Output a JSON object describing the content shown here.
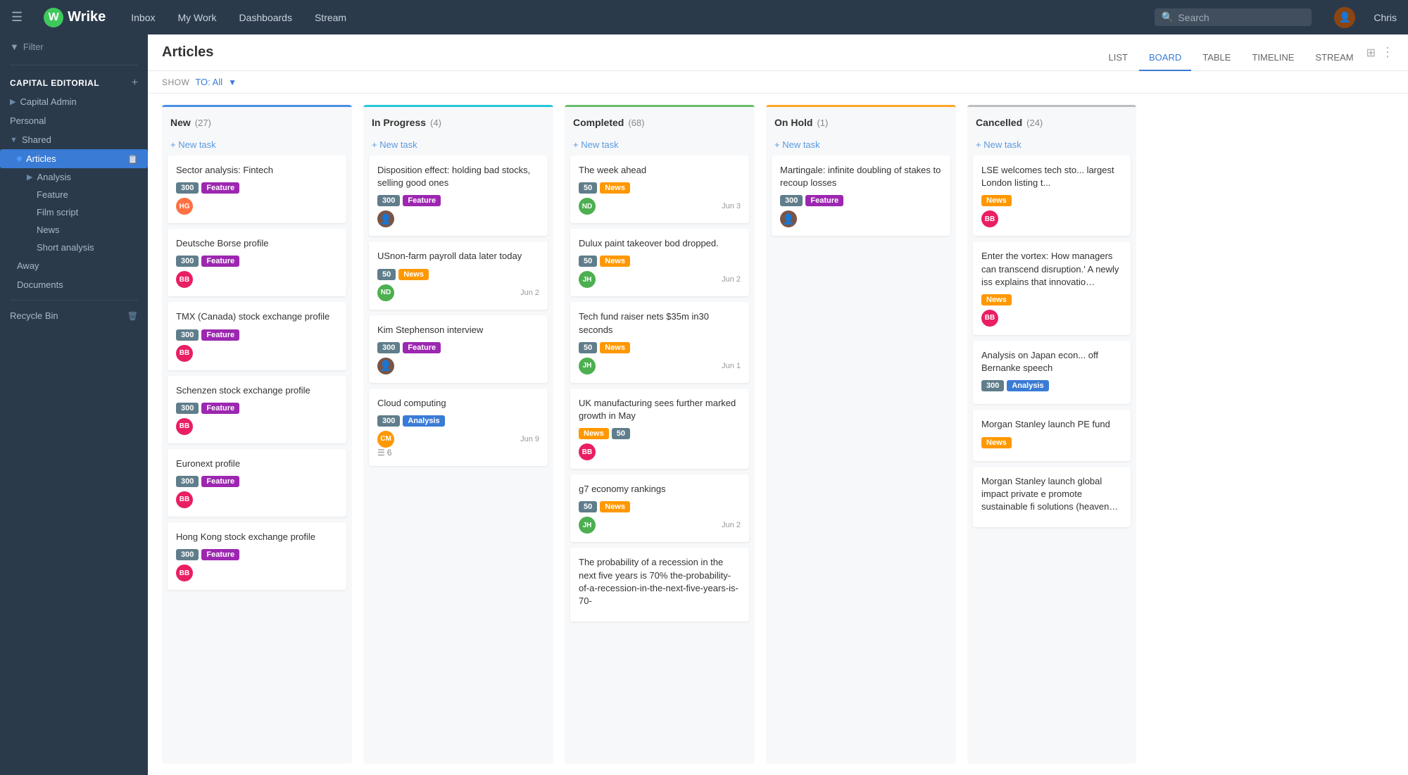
{
  "topnav": {
    "logo_text": "Wrike",
    "hamburger": "☰",
    "nav_items": [
      "Inbox",
      "My Work",
      "Dashboards",
      "Stream"
    ],
    "search_placeholder": "Search",
    "user_name": "Chris"
  },
  "sidebar": {
    "filter_label": "Filter",
    "capital_editorial": "CAPITAL EDITORIAL",
    "items": [
      {
        "label": "Capital Admin",
        "indent": 0
      },
      {
        "label": "Personal",
        "indent": 0
      },
      {
        "label": "Shared",
        "indent": 0,
        "expanded": true
      },
      {
        "label": "Articles",
        "indent": 1,
        "active": true
      },
      {
        "label": "Analysis",
        "indent": 2
      },
      {
        "label": "Feature",
        "indent": 2
      },
      {
        "label": "Film script",
        "indent": 2
      },
      {
        "label": "News",
        "indent": 2
      },
      {
        "label": "Short analysis",
        "indent": 2
      },
      {
        "label": "Away",
        "indent": 1
      },
      {
        "label": "Documents",
        "indent": 1
      },
      {
        "label": "Recycle Bin",
        "indent": 0
      }
    ]
  },
  "content": {
    "title": "Articles",
    "tabs": [
      "LIST",
      "BOARD",
      "TABLE",
      "TIMELINE",
      "STREAM"
    ],
    "active_tab": "BOARD",
    "filter_label": "SHOW",
    "filter_value": "TO: All"
  },
  "columns": [
    {
      "id": "new",
      "title": "New",
      "count": 27,
      "bar_class": "blue",
      "new_task_label": "+ New task",
      "cards": [
        {
          "title": "Sector analysis: Fintech",
          "tags": [
            {
              "label": "300",
              "class": "num"
            },
            {
              "label": "Feature",
              "class": "feature"
            }
          ],
          "avatar": "HG",
          "avatar_class": "avatar-hg",
          "date": ""
        },
        {
          "title": "Deutsche Borse profile",
          "tags": [
            {
              "label": "300",
              "class": "num"
            },
            {
              "label": "Feature",
              "class": "feature"
            }
          ],
          "avatar": "BB",
          "avatar_class": "avatar-bb",
          "date": ""
        },
        {
          "title": "TMX (Canada) stock exchange profile",
          "tags": [
            {
              "label": "300",
              "class": "num"
            },
            {
              "label": "Feature",
              "class": "feature"
            }
          ],
          "avatar": "BB",
          "avatar_class": "avatar-bb",
          "date": ""
        },
        {
          "title": "Schenzen stock exchange profile",
          "tags": [
            {
              "label": "300",
              "class": "num"
            },
            {
              "label": "Feature",
              "class": "feature"
            }
          ],
          "avatar": "BB",
          "avatar_class": "avatar-bb",
          "date": ""
        },
        {
          "title": "Euronext profile",
          "tags": [
            {
              "label": "300",
              "class": "num"
            },
            {
              "label": "Feature",
              "class": "feature"
            }
          ],
          "avatar": "BB",
          "avatar_class": "avatar-bb",
          "date": ""
        },
        {
          "title": "Hong Kong stock exchange profile",
          "tags": [
            {
              "label": "300",
              "class": "num"
            },
            {
              "label": "Feature",
              "class": "feature"
            }
          ],
          "avatar": "BB",
          "avatar_class": "avatar-bb",
          "date": ""
        }
      ]
    },
    {
      "id": "inprogress",
      "title": "In Progress",
      "count": 4,
      "bar_class": "teal",
      "new_task_label": "+ New task",
      "cards": [
        {
          "title": "Disposition effect: holding bad stocks, selling good ones",
          "tags": [
            {
              "label": "300",
              "class": "num"
            },
            {
              "label": "Feature",
              "class": "feature"
            }
          ],
          "avatar": "photo",
          "avatar_class": "avatar-photo",
          "date": ""
        },
        {
          "title": "USnon-farm payroll data later today",
          "tags": [
            {
              "label": "50",
              "class": "num"
            },
            {
              "label": "News",
              "class": "news"
            }
          ],
          "avatar": "ND",
          "avatar_class": "avatar-nd",
          "date": "Jun 2"
        },
        {
          "title": "Kim Stephenson interview",
          "tags": [
            {
              "label": "300",
              "class": "num"
            },
            {
              "label": "Feature",
              "class": "feature"
            }
          ],
          "avatar": "photo",
          "avatar_class": "avatar-photo",
          "date": ""
        },
        {
          "title": "Cloud computing",
          "tags": [
            {
              "label": "300",
              "class": "num"
            },
            {
              "label": "Analysis",
              "class": "analysis"
            }
          ],
          "avatar": "CM",
          "avatar_class": "avatar-cm",
          "date": "Jun 9",
          "subtasks": 6
        }
      ]
    },
    {
      "id": "completed",
      "title": "Completed",
      "count": 68,
      "bar_class": "green",
      "new_task_label": "+ New task",
      "cards": [
        {
          "title": "The week ahead",
          "tags": [
            {
              "label": "50",
              "class": "num"
            },
            {
              "label": "News",
              "class": "news"
            }
          ],
          "avatar": "ND",
          "avatar_class": "avatar-nd",
          "date": "Jun 3"
        },
        {
          "title": "Dulux paint takeover bod dropped.",
          "tags": [
            {
              "label": "50",
              "class": "num"
            },
            {
              "label": "News",
              "class": "news"
            }
          ],
          "avatar": "JH",
          "avatar_class": "avatar-jh",
          "date": "Jun 2"
        },
        {
          "title": "Tech fund raiser nets $35m in30 seconds",
          "tags": [
            {
              "label": "50",
              "class": "num"
            },
            {
              "label": "News",
              "class": "news"
            }
          ],
          "avatar": "JH",
          "avatar_class": "avatar-jh",
          "date": "Jun 1"
        },
        {
          "title": "UK manufacturing sees further marked growth in May",
          "tags": [
            {
              "label": "News",
              "class": "news"
            },
            {
              "label": "50",
              "class": "num"
            }
          ],
          "avatar": "BB",
          "avatar_class": "avatar-bb",
          "date": ""
        },
        {
          "title": "g7 economy rankings",
          "tags": [
            {
              "label": "50",
              "class": "num"
            },
            {
              "label": "News",
              "class": "news"
            }
          ],
          "avatar": "JH",
          "avatar_class": "avatar-jh",
          "date": "Jun 2"
        },
        {
          "title": "The probability of a recession in the next five years is 70% the-probability-of-a-recession-in-the-next-five-years-is-70-",
          "tags": [],
          "avatar": "",
          "avatar_class": "",
          "date": ""
        }
      ]
    },
    {
      "id": "onhold",
      "title": "On Hold",
      "count": 1,
      "bar_class": "orange",
      "new_task_label": "+ New task",
      "cards": [
        {
          "title": "Martingale: infinite doubling of stakes to recoup losses",
          "tags": [
            {
              "label": "300",
              "class": "num"
            },
            {
              "label": "Feature",
              "class": "feature"
            }
          ],
          "avatar": "photo",
          "avatar_class": "avatar-photo",
          "date": ""
        }
      ]
    },
    {
      "id": "cancelled",
      "title": "Cancelled",
      "count": 24,
      "bar_class": "gray",
      "new_task_label": "+ New task",
      "cards": [
        {
          "title": "LSE welcomes tech sto... largest London listing t...",
          "tags": [
            {
              "label": "News",
              "class": "news"
            }
          ],
          "avatar": "BB",
          "avatar_class": "avatar-bb",
          "date": ""
        },
        {
          "title": "Enter the vortex: How managers can transcend disruption.' A newly iss explains that innovatio technology has unleash vortex that promises t...",
          "tags": [
            {
              "label": "News",
              "class": "news"
            }
          ],
          "avatar": "BB",
          "avatar_class": "avatar-bb",
          "date": ""
        },
        {
          "title": "Analysis on Japan econ... off Bernanke speech",
          "tags": [
            {
              "label": "300",
              "class": "num"
            },
            {
              "label": "Analysis",
              "class": "analysis"
            }
          ],
          "avatar": "",
          "avatar_class": "",
          "date": ""
        },
        {
          "title": "Morgan Stanley launch PE fund",
          "tags": [
            {
              "label": "News",
              "class": "news"
            }
          ],
          "avatar": "",
          "avatar_class": "",
          "date": ""
        },
        {
          "title": "Morgan Stanley launch global impact private e promote sustainable fi solutions (heaven help...",
          "tags": [],
          "avatar": "",
          "avatar_class": "",
          "date": ""
        }
      ]
    }
  ]
}
